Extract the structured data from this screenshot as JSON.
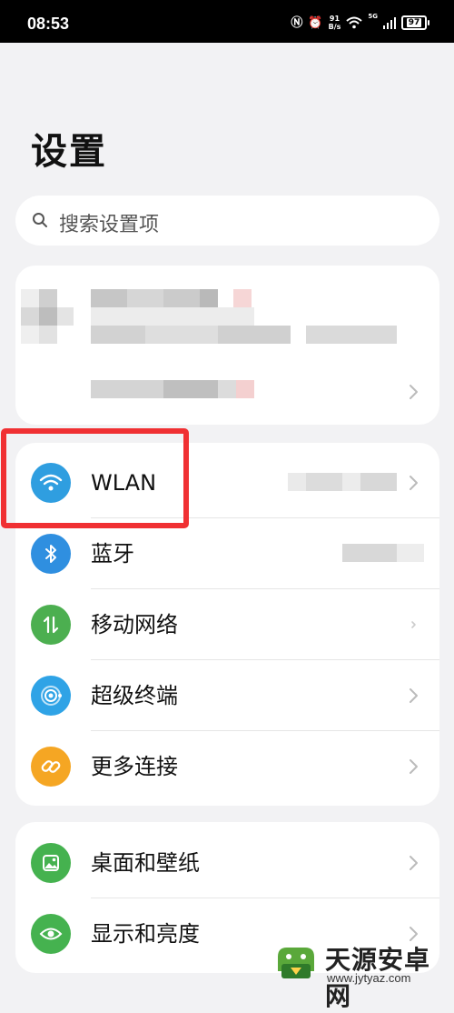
{
  "status_bar": {
    "time": "08:53",
    "speed_value": "91",
    "speed_unit": "B/s",
    "network": "5G",
    "battery": "97"
  },
  "page": {
    "title": "设置"
  },
  "search": {
    "placeholder": "搜索设置项"
  },
  "sections": {
    "connectivity": [
      {
        "label": "WLAN",
        "icon": "wifi-icon",
        "color": "#2f9ee0"
      },
      {
        "label": "蓝牙",
        "icon": "bluetooth-icon",
        "color": "#2f8fe0"
      },
      {
        "label": "移动网络",
        "icon": "mobile-data-icon",
        "color": "#4caf50"
      },
      {
        "label": "超级终端",
        "icon": "super-device-icon",
        "color": "#2fa3e6"
      },
      {
        "label": "更多连接",
        "icon": "link-icon",
        "color": "#f5a623"
      }
    ],
    "display": [
      {
        "label": "桌面和壁纸",
        "icon": "wallpaper-icon",
        "color": "#45b24f"
      },
      {
        "label": "显示和亮度",
        "icon": "eye-icon",
        "color": "#45b24f"
      }
    ]
  },
  "colors": {
    "highlight": "#f03033",
    "background": "#f2f2f4"
  },
  "watermark": {
    "name": "天源安卓网",
    "url": "www.jytyaz.com"
  }
}
